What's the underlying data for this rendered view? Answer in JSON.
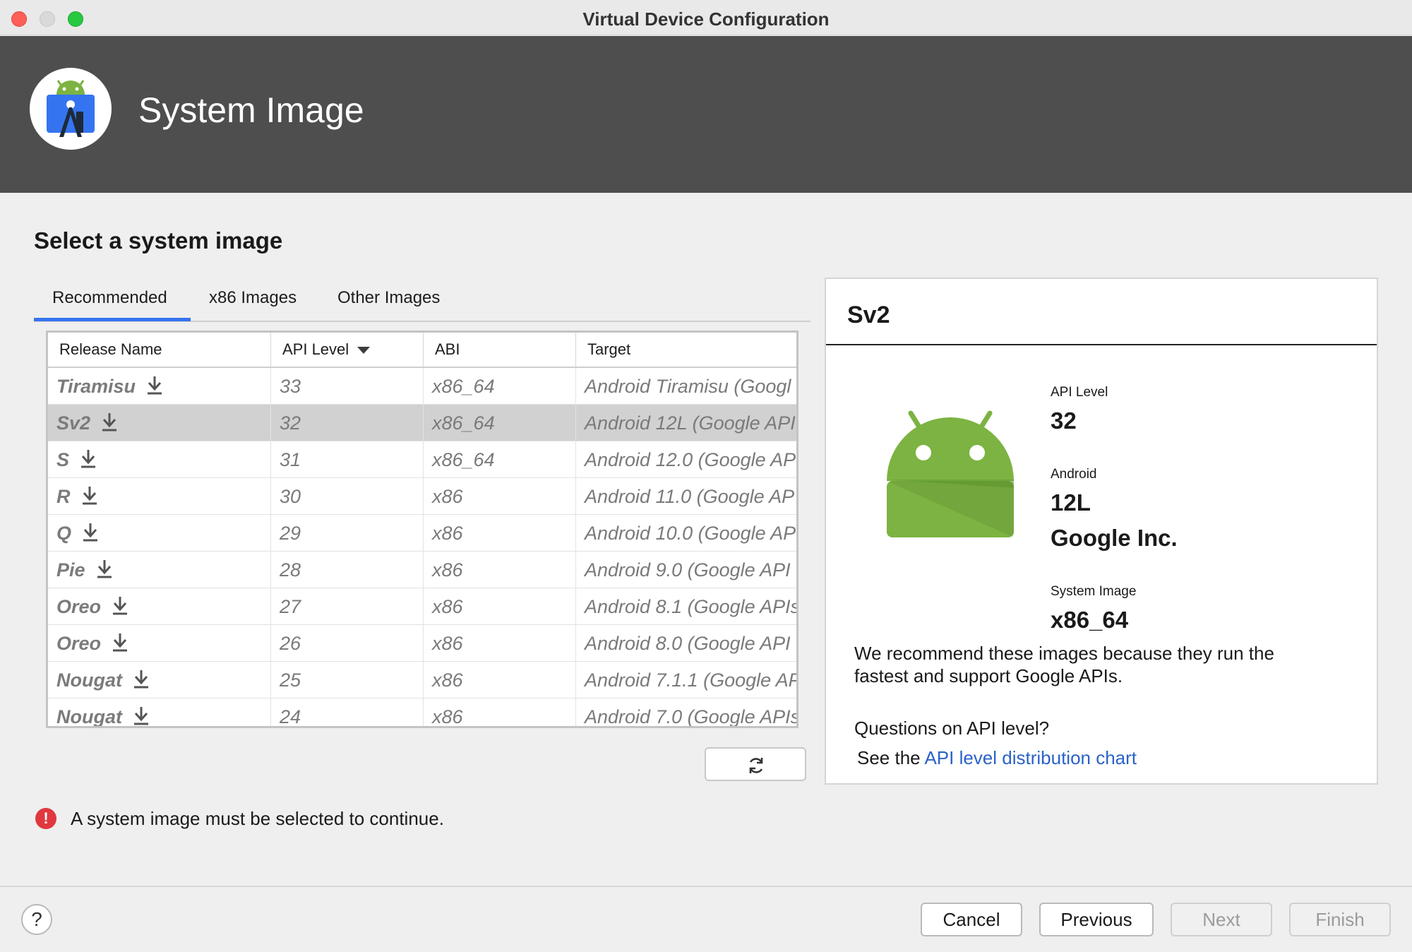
{
  "window": {
    "title": "Virtual Device Configuration"
  },
  "header": {
    "title": "System Image"
  },
  "section_title": "Select a system image",
  "tabs": [
    {
      "label": "Recommended",
      "active": true
    },
    {
      "label": "x86 Images",
      "active": false
    },
    {
      "label": "Other Images",
      "active": false
    }
  ],
  "table": {
    "columns": [
      "Release Name",
      "API Level",
      "ABI",
      "Target"
    ],
    "rows": [
      {
        "name": "Tiramisu",
        "api": "33",
        "abi": "x86_64",
        "target": "Android Tiramisu (Googl"
      },
      {
        "name": "Sv2",
        "api": "32",
        "abi": "x86_64",
        "target": "Android 12L (Google API"
      },
      {
        "name": "S",
        "api": "31",
        "abi": "x86_64",
        "target": "Android 12.0 (Google AP"
      },
      {
        "name": "R",
        "api": "30",
        "abi": "x86",
        "target": "Android 11.0 (Google AP"
      },
      {
        "name": "Q",
        "api": "29",
        "abi": "x86",
        "target": "Android 10.0 (Google AP"
      },
      {
        "name": "Pie",
        "api": "28",
        "abi": "x86",
        "target": "Android 9.0 (Google API"
      },
      {
        "name": "Oreo",
        "api": "27",
        "abi": "x86",
        "target": "Android 8.1 (Google APIs"
      },
      {
        "name": "Oreo",
        "api": "26",
        "abi": "x86",
        "target": "Android 8.0 (Google API"
      },
      {
        "name": "Nougat",
        "api": "25",
        "abi": "x86",
        "target": "Android 7.1.1 (Google AP"
      },
      {
        "name": "Nougat",
        "api": "24",
        "abi": "x86",
        "target": "Android 7.0 (Google APIs"
      }
    ],
    "selected_index": 1,
    "sort_column": "API Level"
  },
  "detail": {
    "title": "Sv2",
    "api_label": "API Level",
    "api_value": "32",
    "android_label": "Android",
    "android_version": "12L",
    "vendor": "Google Inc.",
    "system_image_label": "System Image",
    "system_image_value": "x86_64",
    "recommend_line1": "We recommend these images because they run the",
    "recommend_line2": "fastest and support Google APIs.",
    "question": "Questions on API level?",
    "see_the": "See the",
    "link_text": "API level distribution chart"
  },
  "error": {
    "message": "A system image must be selected to continue."
  },
  "footer": {
    "help": "?",
    "cancel": "Cancel",
    "previous": "Previous",
    "next": "Next",
    "finish": "Finish"
  },
  "colors": {
    "header_bg": "#4e4e4e",
    "accent": "#3574f0",
    "android_green": "#7cb342",
    "link": "#2a62c9",
    "error": "#e0383e"
  }
}
